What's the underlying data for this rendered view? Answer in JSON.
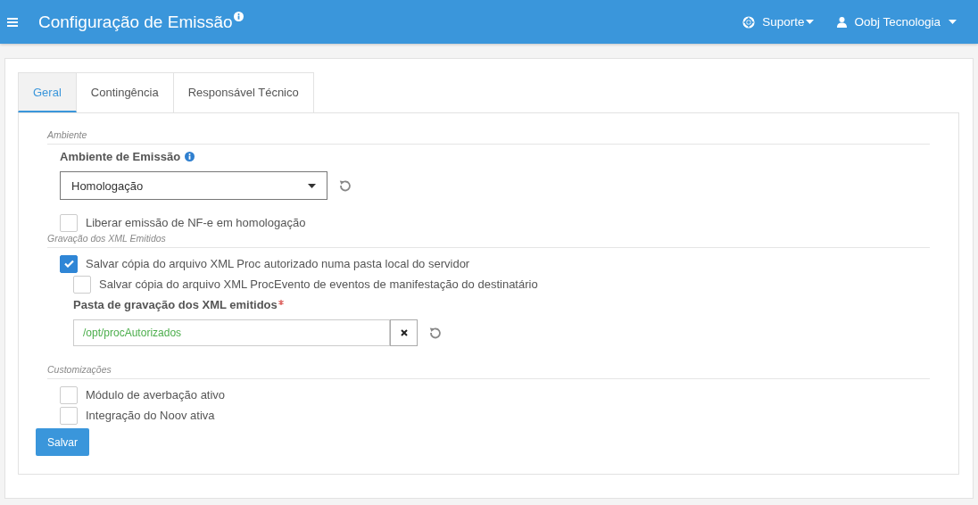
{
  "header": {
    "title": "Configuração de Emissão",
    "nav": [
      {
        "kind": "support",
        "label": "Suporte"
      },
      {
        "kind": "user",
        "label": "Oobj Tecnologia"
      }
    ]
  },
  "tabs": [
    {
      "label": "Geral",
      "selected": true
    },
    {
      "label": "Contingência",
      "selected": false
    },
    {
      "label": "Responsável Técnico",
      "selected": false
    }
  ],
  "sections": [
    {
      "legend": "Ambiente",
      "fields": [
        {
          "kind": "select",
          "label": "Ambiente de Emissão",
          "info": true,
          "value": "Homologação"
        },
        {
          "kind": "checkbox",
          "label": "Liberar emissão de NF-e em homologação",
          "checked": false
        }
      ]
    },
    {
      "legend": "Gravação dos XML Emitidos",
      "fields": [
        {
          "kind": "checkbox",
          "label": "Salvar cópia do arquivo XML Proc autorizado numa pasta local do servidor",
          "checked": true,
          "children": [
            {
              "kind": "checkbox",
              "label": "Salvar cópia do arquivo XML ProcEvento de eventos de manifestação do destinatário",
              "checked": false
            },
            {
              "kind": "text",
              "label": "Pasta de gravação dos XML emitidos",
              "required": true,
              "value": "/opt/procAutorizados"
            }
          ]
        }
      ]
    },
    {
      "legend": "Customizações",
      "fields": [
        {
          "kind": "checkbox",
          "label": "Módulo de averbação ativo",
          "checked": false
        },
        {
          "kind": "checkbox",
          "label": "Integração do Noov ativa",
          "checked": false
        }
      ]
    }
  ],
  "save_button": "Salvar"
}
